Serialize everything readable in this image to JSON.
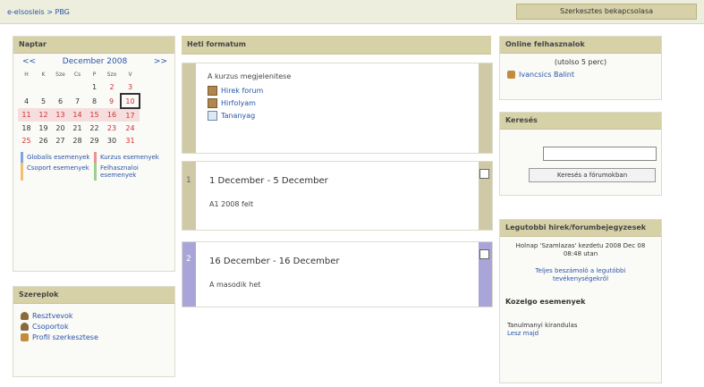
{
  "topbar": {
    "breadcrumb": "e-elsosleis > PBG",
    "switch_role_label": "Szerkesztes bekapcsolasa"
  },
  "calendar": {
    "title": "Naptar",
    "prev": "<<",
    "month_label": "December 2008",
    "next": ">>",
    "weekdays": [
      "H",
      "K",
      "Sze",
      "Cs",
      "P",
      "Szo",
      "V"
    ],
    "weeks": [
      [
        "",
        "",
        "",
        "",
        "1",
        "2",
        "3"
      ],
      [
        "4",
        "5",
        "6",
        "7",
        "8",
        "9",
        "10"
      ],
      [
        "11",
        "12",
        "13",
        "14",
        "15",
        "16",
        "17"
      ],
      [
        "18",
        "19",
        "20",
        "21",
        "22",
        "23",
        "24"
      ],
      [
        "25",
        "26",
        "27",
        "28",
        "29",
        "30",
        "31"
      ]
    ],
    "keys": [
      "Globalis esemenyek",
      "Kurzus esemenyek",
      "Csoport esemenyek",
      "Felhasznaloi esemenyek"
    ]
  },
  "people": {
    "title": "Szereplok",
    "items": [
      "Resztvevok",
      "Csoportok",
      "Profil szerkesztese"
    ]
  },
  "topics": {
    "title": "Heti formatum",
    "intro": {
      "label": "A kurzus megjelenitese",
      "items": [
        "Hirek forum",
        "Hirfolyam",
        "Tananyag"
      ]
    },
    "sections": [
      {
        "number": "1",
        "title": "1 December - 5 December",
        "summary": "A1 2008 felt"
      },
      {
        "number": "2",
        "title": "16 December - 16 December",
        "summary": "A masodik het"
      }
    ]
  },
  "online_users": {
    "title": "Online felhasznalok",
    "subtitle": "(utolso 5 perc)",
    "user": "Ivancsics Balint"
  },
  "search": {
    "title": "Keresés",
    "input_value": "",
    "button_label": "Keresés a fórumokban"
  },
  "news": {
    "title": "Legutobbi hirek/forumbejegyzesek",
    "item": "Holnap 'Szamlazas' kezdetu 2008 Dec 08 08:48 utan",
    "link": "Teljes beszámoló a legutóbbi tevékenységekről",
    "upcoming_title": "Kozelgo esemenyek",
    "upcoming_text": "Tanulmanyi kirandulas",
    "upcoming_link": "Lesz majd"
  }
}
